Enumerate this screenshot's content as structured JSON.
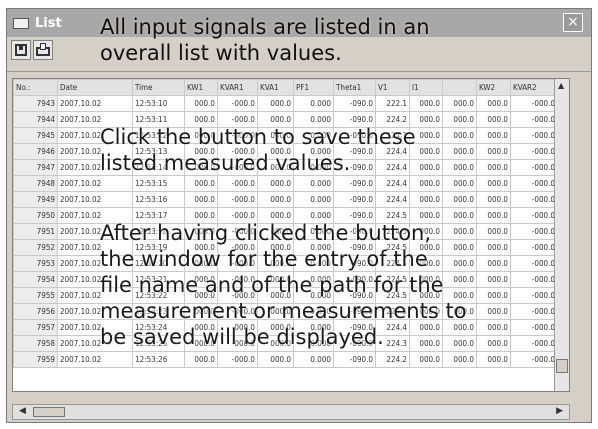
{
  "window": {
    "title": "List",
    "close_label": "×"
  },
  "toolbar": {
    "save_icon": "save-icon",
    "print_icon": "print-icon"
  },
  "table": {
    "columns": [
      "No.:",
      "Date",
      "Time",
      "KW1",
      "KVAR1",
      "KVA1",
      "PF1",
      "Theta1",
      "V1",
      "I1",
      "",
      "KW2",
      "KVAR2"
    ],
    "rows": [
      [
        "7943",
        "2007.10.02",
        "12:53:10",
        "000.0",
        "-000.0",
        "000.0",
        "0.000",
        "-090.0",
        "222.1",
        "000.0",
        "000.0",
        "000.0",
        "-000.0"
      ],
      [
        "7944",
        "2007.10.02",
        "12:53:11",
        "000.0",
        "-000.0",
        "000.0",
        "0.000",
        "-090.0",
        "224.2",
        "000.0",
        "000.0",
        "000.0",
        "-000.0"
      ],
      [
        "7945",
        "2007.10.02",
        "12:53:12",
        "000.0",
        "-000.0",
        "000.0",
        "0.000",
        "-090.0",
        "224.3",
        "000.0",
        "000.0",
        "000.0",
        "-000.0"
      ],
      [
        "7946",
        "2007.10.02",
        "12:53:13",
        "000.0",
        "-000.0",
        "000.0",
        "0.000",
        "-090.0",
        "224.4",
        "000.0",
        "000.0",
        "000.0",
        "-000.0"
      ],
      [
        "7947",
        "2007.10.02",
        "12:53:14",
        "000.0",
        "-000.0",
        "000.0",
        "0.000",
        "-090.0",
        "224.4",
        "000.0",
        "000.0",
        "000.0",
        "-000.0"
      ],
      [
        "7948",
        "2007.10.02",
        "12:53:15",
        "000.0",
        "-000.0",
        "000.0",
        "0.000",
        "-090.0",
        "224.4",
        "000.0",
        "000.0",
        "000.0",
        "-000.0"
      ],
      [
        "7949",
        "2007.10.02",
        "12:53:16",
        "000.0",
        "-000.0",
        "000.0",
        "0.000",
        "-090.0",
        "224.4",
        "000.0",
        "000.0",
        "000.0",
        "-000.0"
      ],
      [
        "7950",
        "2007.10.02",
        "12:53:17",
        "000.0",
        "-000.0",
        "000.0",
        "0.000",
        "-090.0",
        "224.5",
        "000.0",
        "000.0",
        "000.0",
        "-000.0"
      ],
      [
        "7951",
        "2007.10.02",
        "12:53:18",
        "000.0",
        "-000.0",
        "000.0",
        "0.000",
        "-090.0",
        "224.5",
        "000.0",
        "000.0",
        "000.0",
        "-000.0"
      ],
      [
        "7952",
        "2007.10.02",
        "12:53:19",
        "000.0",
        "-000.0",
        "000.0",
        "0.000",
        "-090.0",
        "224.5",
        "000.0",
        "000.0",
        "000.0",
        "-000.0"
      ],
      [
        "7953",
        "2007.10.02",
        "12:53:20",
        "000.0",
        "-000.0",
        "000.0",
        "0.000",
        "-090.0",
        "224.5",
        "000.0",
        "000.0",
        "000.0",
        "-000.0"
      ],
      [
        "7954",
        "2007.10.02",
        "12:53:21",
        "000.0",
        "-000.0",
        "000.0",
        "0.000",
        "-090.0",
        "224.5",
        "000.0",
        "000.0",
        "000.0",
        "-000.0"
      ],
      [
        "7955",
        "2007.10.02",
        "12:53:22",
        "000.0",
        "-000.0",
        "000.0",
        "0.000",
        "-090.0",
        "224.5",
        "000.0",
        "000.0",
        "000.0",
        "-000.0"
      ],
      [
        "7956",
        "2007.10.02",
        "12:53:23",
        "000.0",
        "-000.0",
        "000.0",
        "0.000",
        "-090.0",
        "224.5",
        "000.0",
        "000.0",
        "000.0",
        "-000.0"
      ],
      [
        "7957",
        "2007.10.02",
        "12:53:24",
        "000.0",
        "-000.0",
        "000.0",
        "0.000",
        "-090.0",
        "224.4",
        "000.0",
        "000.0",
        "000.0",
        "-000.0"
      ],
      [
        "7958",
        "2007.10.02",
        "12:53:25",
        "000.0",
        "-000.0",
        "000.0",
        "0.000",
        "-090.0",
        "224.3",
        "000.0",
        "000.0",
        "000.0",
        "-000.0"
      ],
      [
        "7959",
        "2007.10.02",
        "12:53:26",
        "000.0",
        "-000.0",
        "000.0",
        "0.000",
        "-090.0",
        "224.2",
        "000.0",
        "000.0",
        "000.0",
        "-000.0"
      ]
    ]
  },
  "annotations": {
    "top": [
      "All input signals are listed in an",
      "overall list with values."
    ],
    "middle": [
      "Click the  button to save these",
      "listed measured values."
    ],
    "bottom": [
      "After having clicked the button,",
      "the window for the entry of the",
      "file name and of the path for the",
      "measurement or measurements to",
      "be saved will be displayed."
    ]
  }
}
